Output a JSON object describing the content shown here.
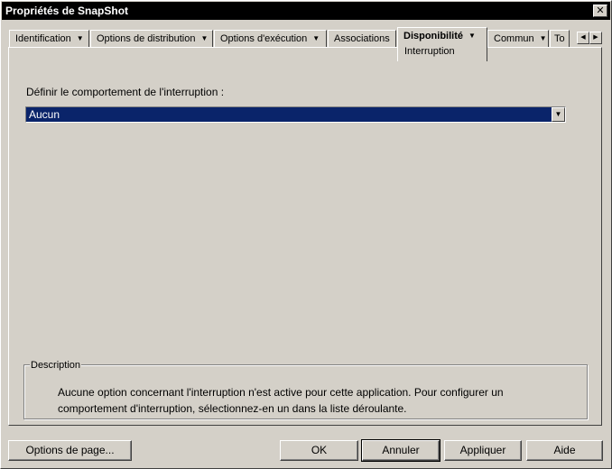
{
  "window": {
    "title": "Propriétés de SnapShot",
    "close_glyph": "✕"
  },
  "tabs": [
    {
      "label": "Identification",
      "has_menu": true
    },
    {
      "label": "Options de distribution",
      "has_menu": true
    },
    {
      "label": "Options d'exécution",
      "has_menu": true
    },
    {
      "label": "Associations",
      "has_menu": false
    },
    {
      "label": "Disponibilité",
      "has_menu": true,
      "active": true,
      "subpage": "Interruption"
    },
    {
      "label": "Commun",
      "has_menu": true
    },
    {
      "label": "To",
      "has_menu": false
    }
  ],
  "tab_scroll": {
    "left": "◀",
    "right": "▶"
  },
  "menu_arrow": "▼",
  "content": {
    "field_label": "Définir le comportement de l'interruption :",
    "select_value": "Aucun",
    "select_arrow": "▼",
    "description_legend": "Description",
    "description_text": "Aucune option concernant l'interruption n'est active pour cette application. Pour configurer un comportement d'interruption, sélectionnez-en un dans la liste déroulante."
  },
  "buttons": {
    "page_options": "Options de page...",
    "ok": "OK",
    "cancel": "Annuler",
    "apply": "Appliquer",
    "help": "Aide"
  },
  "colors": {
    "titlebar": "#000000",
    "selection": "#0a246a",
    "face": "#d4d0c8"
  }
}
